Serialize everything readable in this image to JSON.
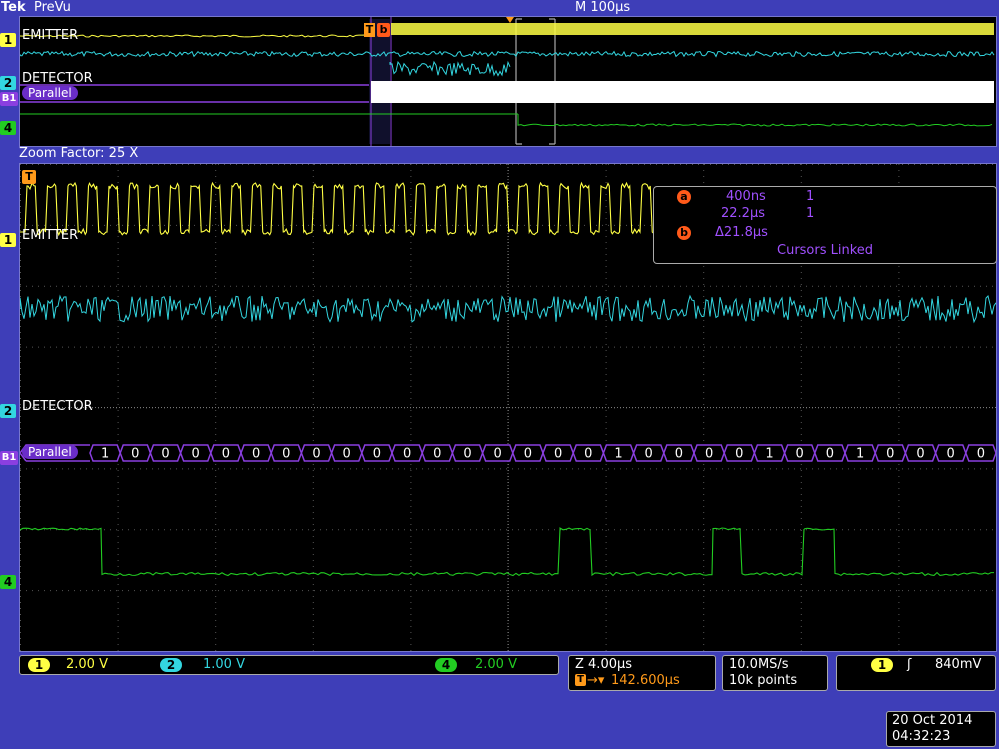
{
  "header": {
    "brand": "Tek",
    "mode": "PreVu",
    "timebase": "M 100µs"
  },
  "overview": {
    "channels": [
      {
        "num": "1",
        "name": "EMITTER",
        "color": "#ffff44"
      },
      {
        "num": "2",
        "name": "DETECTOR",
        "color": "#33d6e0"
      },
      {
        "num": "B1",
        "name": "Parallel",
        "color": "#8a3fe0"
      },
      {
        "num": "4",
        "name": "",
        "color": "#22cc22"
      }
    ]
  },
  "zoom": {
    "label": "Zoom Factor: 25 X"
  },
  "main": {
    "trigger_marker": "T",
    "ch1_label": "EMITTER",
    "ch2_label": "DETECTOR",
    "bus_label": "Parallel",
    "bus_values": [
      "1",
      "0",
      "0",
      "0",
      "0",
      "0",
      "0",
      "0",
      "0",
      "0",
      "0",
      "0",
      "0",
      "0",
      "0",
      "0",
      "0",
      "1",
      "0",
      "0",
      "0",
      "0",
      "1",
      "0",
      "0",
      "1",
      "0",
      "0",
      "0",
      "0",
      "0"
    ]
  },
  "cursors": {
    "a_marker": "a",
    "b_marker": "b",
    "a_time": "400ns",
    "a_value": "1",
    "b_time": "22.2µs",
    "b_value": "1",
    "delta": "Δ21.8µs",
    "linked": "Cursors Linked"
  },
  "status": {
    "ch1_num": "1",
    "ch1_scale": "2.00 V",
    "ch2_num": "2",
    "ch2_scale": "1.00 V",
    "ch4_num": "4",
    "ch4_scale": "2.00 V",
    "zoom_scale": "Z 4.00µs",
    "trigger_position": "142.600µs",
    "sample_rate": "10.0MS/s",
    "record_length": "10k points",
    "trig_source": "1",
    "trig_slope": "ʃ",
    "trig_level": "840mV",
    "date": "20 Oct  2014",
    "time": "04:32:23"
  }
}
